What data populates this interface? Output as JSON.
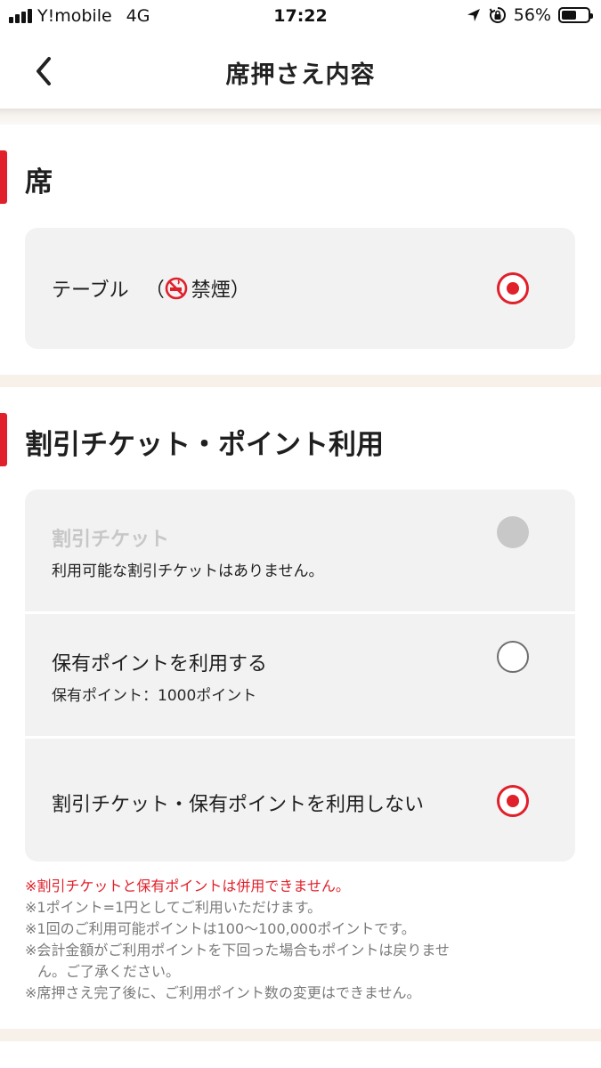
{
  "status_bar": {
    "carrier": "Y!mobile",
    "network": "4G",
    "time": "17:22",
    "battery": "56%",
    "battery_level": 0.56
  },
  "nav": {
    "title": "席押さえ内容"
  },
  "seat_section": {
    "title": "席",
    "option": {
      "label": "テーブル",
      "smoking": "禁煙",
      "paren_open": "（",
      "paren_close": "）",
      "selected": true
    }
  },
  "discount_section": {
    "title": "割引チケット・ポイント利用",
    "options": [
      {
        "label": "割引チケット",
        "sub": "利用可能な割引チケットはありません。",
        "state": "disabled"
      },
      {
        "label": "保有ポイントを利用する",
        "sub": "保有ポイント：1000ポイント",
        "state": "off"
      },
      {
        "label": "割引チケット・保有ポイントを利用しない",
        "state": "on"
      }
    ]
  },
  "notes": [
    "※割引チケットと保有ポイントは併用できません。",
    "※1ポイント=1円としてご利用いただけます。",
    "※1回のご利用可能ポイントは100〜100,000ポイントです。",
    "※会計金額がご利用ポイントを下回った場合もポイントは戻りませ",
    "ん。ご了承ください。",
    "※席押さえ完了後に、ご利用ポイント数の変更はできません。"
  ],
  "colors": {
    "accent": "#e0202b",
    "card_bg": "#f2f2f2",
    "band": "#f8f1ea"
  }
}
